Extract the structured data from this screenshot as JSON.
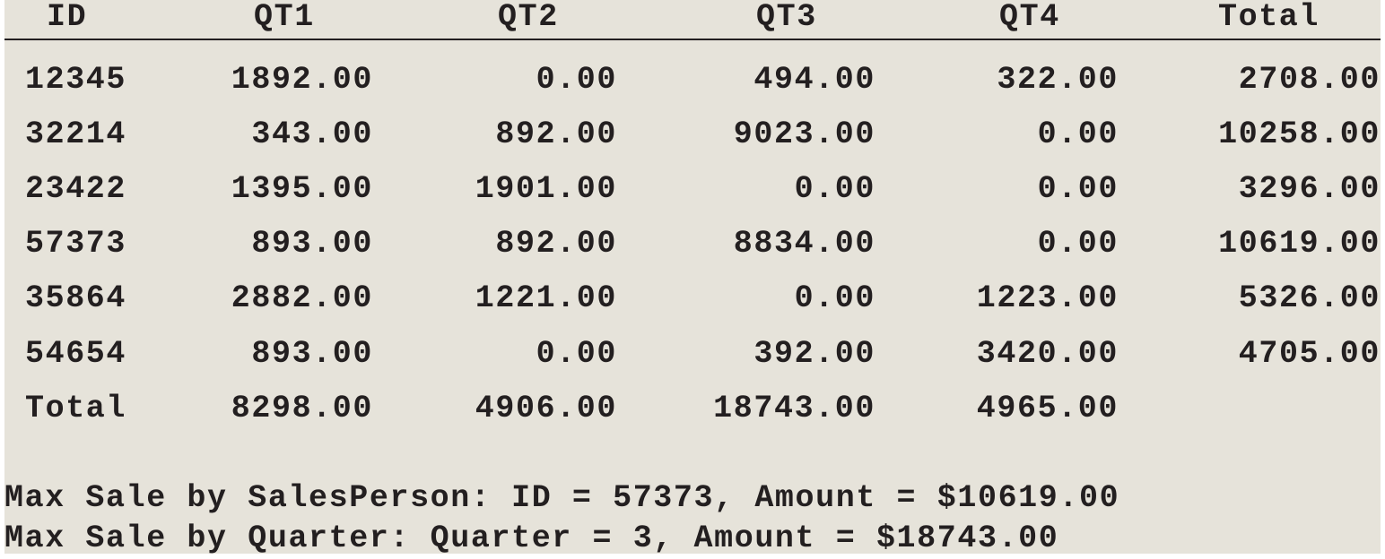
{
  "table": {
    "headers": [
      "ID",
      "QT1",
      "QT2",
      "QT3",
      "QT4",
      "Total"
    ],
    "rows": [
      [
        "12345",
        "1892.00",
        "0.00",
        "494.00",
        "322.00",
        "2708.00"
      ],
      [
        "32214",
        "343.00",
        "892.00",
        "9023.00",
        "0.00",
        "10258.00"
      ],
      [
        "23422",
        "1395.00",
        "1901.00",
        "0.00",
        "0.00",
        "3296.00"
      ],
      [
        "57373",
        "893.00",
        "892.00",
        "8834.00",
        "0.00",
        "10619.00"
      ],
      [
        "35864",
        "2882.00",
        "1221.00",
        "0.00",
        "1223.00",
        "5326.00"
      ],
      [
        "54654",
        "893.00",
        "0.00",
        "392.00",
        "3420.00",
        "4705.00"
      ]
    ],
    "totals_row": [
      "Total",
      "8298.00",
      "4906.00",
      "18743.00",
      "4965.00"
    ]
  },
  "summary": {
    "max_by_salesperson": "Max Sale by SalesPerson: ID = 57373, Amount = $10619.00",
    "max_by_quarter": "Max Sale by Quarter: Quarter = 3, Amount = $18743.00"
  },
  "colors": {
    "background": "#e6e3da",
    "text": "#231f20"
  }
}
